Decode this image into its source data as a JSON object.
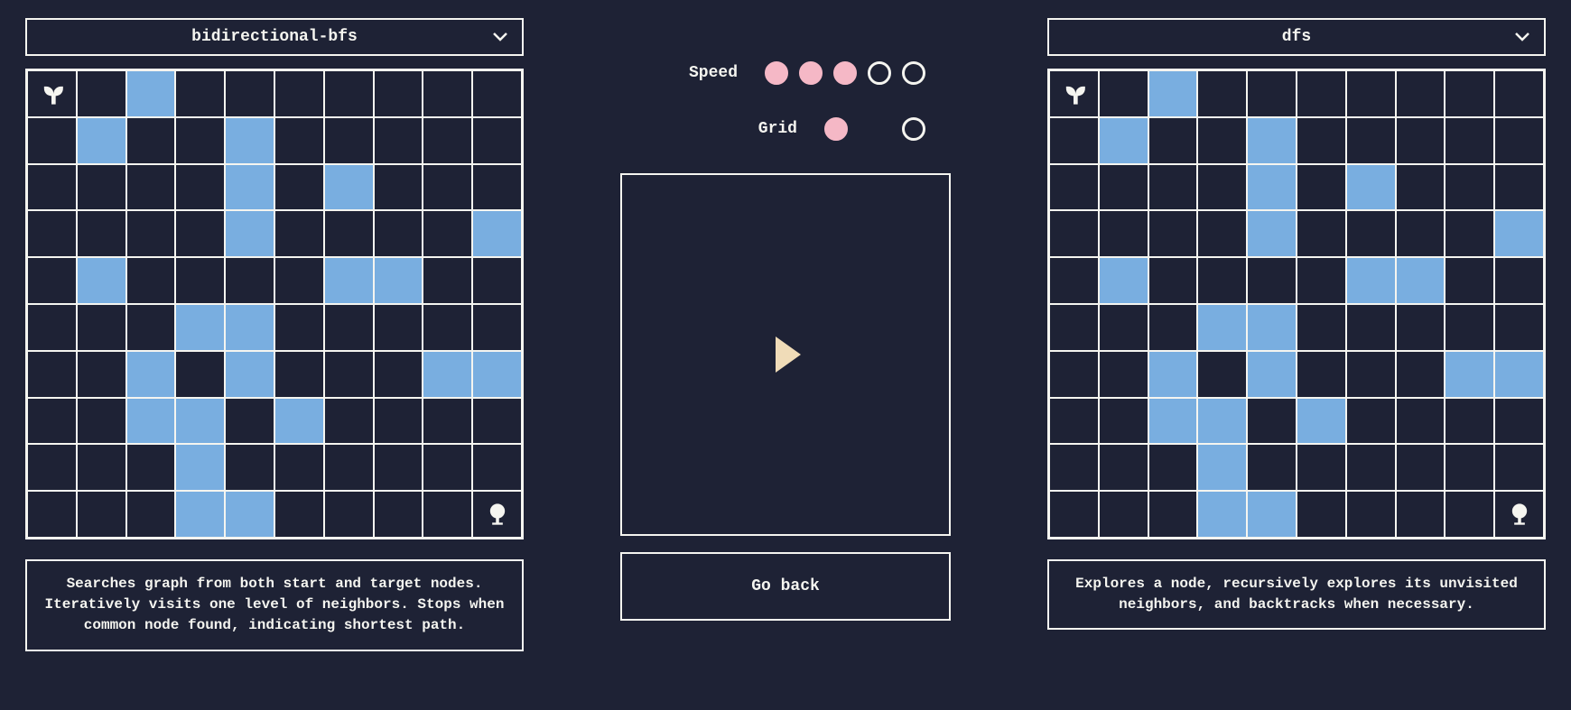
{
  "left": {
    "algorithm": "bidirectional-bfs",
    "description": "Searches graph from both start and target nodes. Iteratively visits one level of neighbors. Stops when common node found, indicating shortest path.",
    "walls": [
      [
        0,
        2
      ],
      [
        1,
        1
      ],
      [
        1,
        4
      ],
      [
        2,
        4
      ],
      [
        2,
        6
      ],
      [
        3,
        4
      ],
      [
        3,
        9
      ],
      [
        4,
        1
      ],
      [
        4,
        6
      ],
      [
        4,
        7
      ],
      [
        5,
        3
      ],
      [
        5,
        4
      ],
      [
        6,
        2
      ],
      [
        6,
        4
      ],
      [
        6,
        8
      ],
      [
        6,
        9
      ],
      [
        7,
        2
      ],
      [
        7,
        3
      ],
      [
        7,
        5
      ],
      [
        8,
        3
      ],
      [
        9,
        3
      ],
      [
        9,
        4
      ]
    ],
    "start": [
      0,
      0
    ],
    "goal": [
      9,
      9
    ]
  },
  "right": {
    "algorithm": "dfs",
    "description": "Explores a node, recursively explores its unvisited neighbors, and backtracks when necessary.",
    "walls": [
      [
        0,
        2
      ],
      [
        1,
        1
      ],
      [
        1,
        4
      ],
      [
        2,
        4
      ],
      [
        2,
        6
      ],
      [
        3,
        4
      ],
      [
        3,
        9
      ],
      [
        4,
        1
      ],
      [
        4,
        6
      ],
      [
        4,
        7
      ],
      [
        5,
        3
      ],
      [
        5,
        4
      ],
      [
        6,
        2
      ],
      [
        6,
        4
      ],
      [
        6,
        8
      ],
      [
        6,
        9
      ],
      [
        7,
        2
      ],
      [
        7,
        3
      ],
      [
        7,
        5
      ],
      [
        8,
        3
      ],
      [
        9,
        3
      ],
      [
        9,
        4
      ]
    ],
    "start": [
      0,
      0
    ],
    "goal": [
      9,
      9
    ]
  },
  "controls": {
    "speed_label": "Speed",
    "speed_value": 3,
    "speed_max": 5,
    "grid_label": "Grid",
    "grid_value": 0,
    "grid_options": 2,
    "go_back_label": "Go back"
  },
  "grid_size": {
    "rows": 10,
    "cols": 10
  }
}
